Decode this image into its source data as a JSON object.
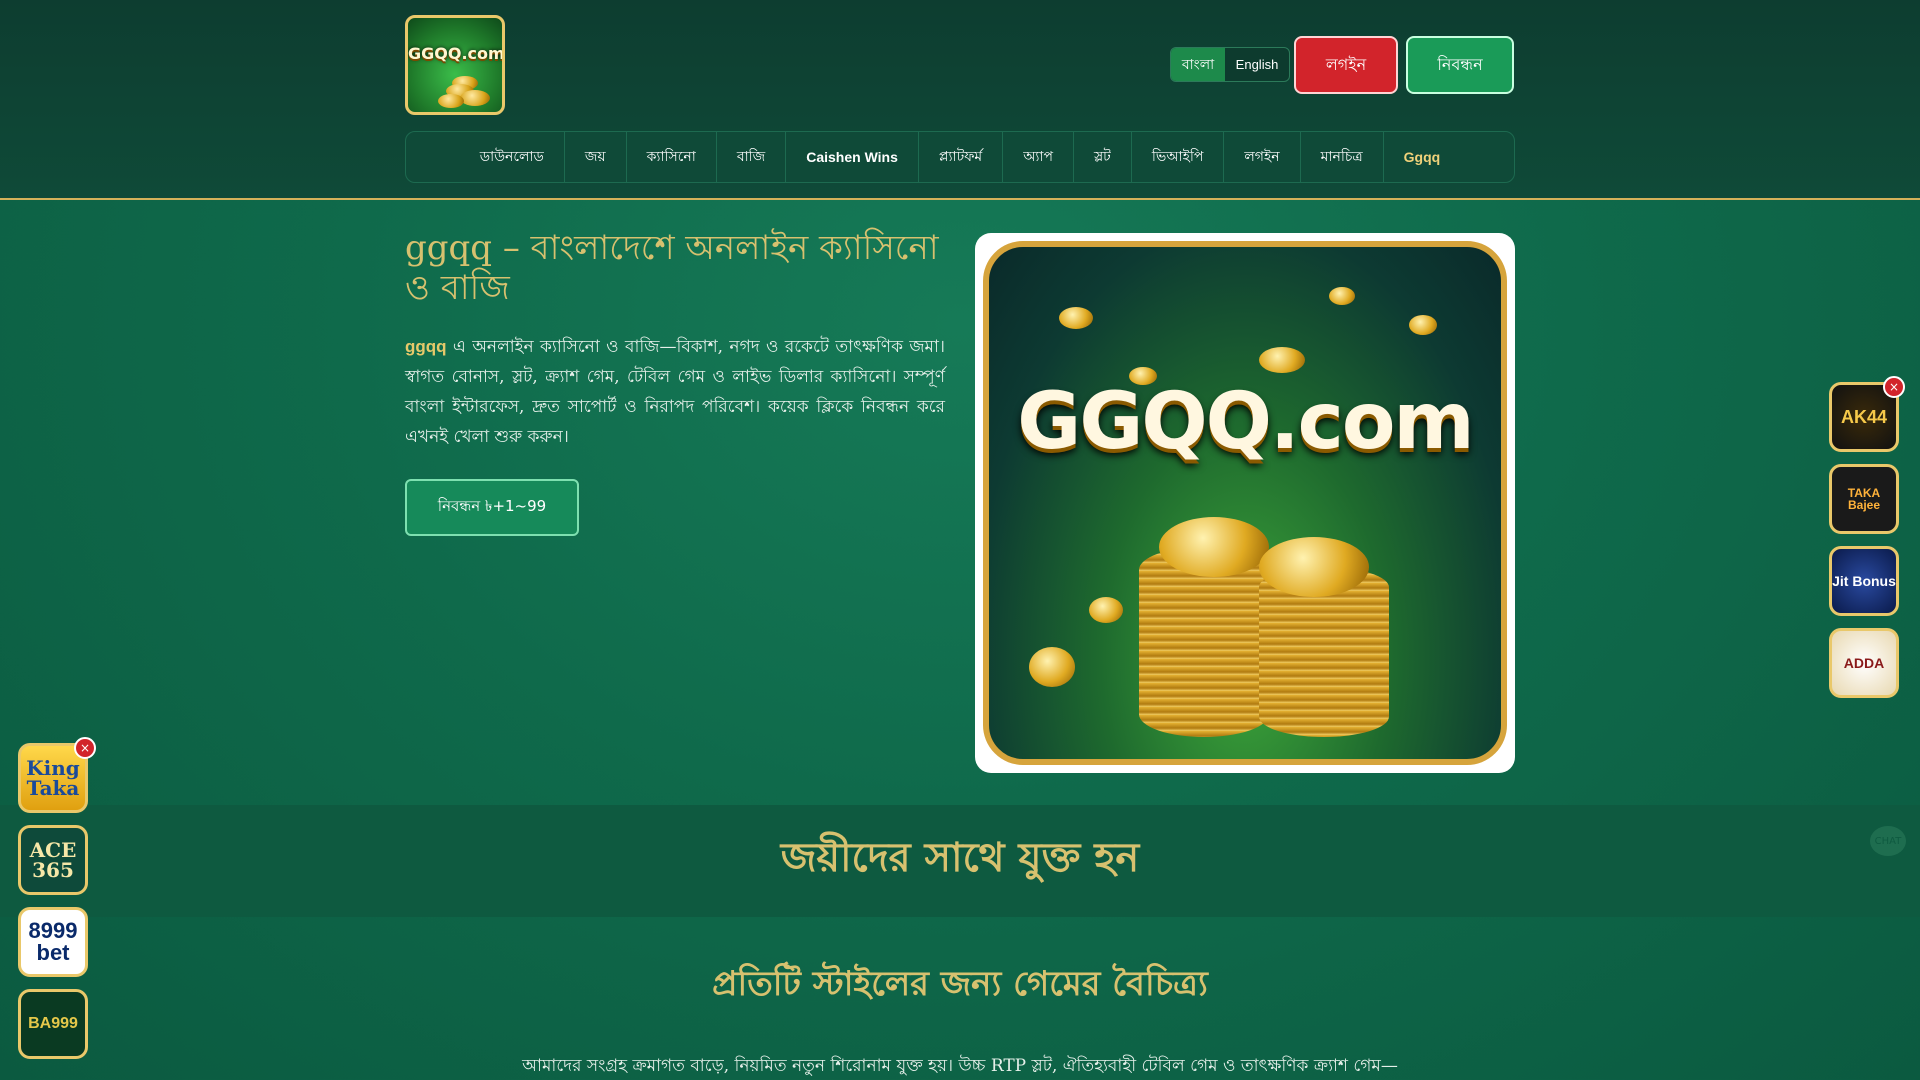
{
  "header": {
    "logo_text": "GGQQ.com",
    "lang_active": "বাংলা",
    "lang_other": "English",
    "login_label": "লগইন",
    "register_label": "নিবন্ধন"
  },
  "nav": {
    "items": [
      "ডাউনলোড",
      "জয়",
      "ক্যাসিনো",
      "বাজি",
      "Caishen Wins",
      "প্ল্যাটফর্ম",
      "অ্যাপ",
      "স্লট",
      "ভিআইপি",
      "লগইন",
      "মানচিত্র",
      "Ggqq"
    ]
  },
  "hero": {
    "title": "ggqq – বাংলাদেশে অনলাইন ক্যাসিনো ও বাজি",
    "desc_brand": "ggqq",
    "desc_rest": " এ অনলাইন ক্যাসিনো ও বাজি—বিকাশ, নগদ ও রকেটে তাৎক্ষণিক জমা। স্বাগত বোনাস, স্লট, ক্র্যাশ গেম, টেবিল গেম ও লাইভ ডিলার ক্যাসিনো। সম্পূর্ণ বাংলা ইন্টারফেস, দ্রুত সাপোর্ট ও নিরাপদ পরিবেশ। কয়েক ক্লিকে নিবন্ধন করে এখনই খেলা শুরু করুন।",
    "cta_label": "নিবন্ধন ৳+1~99",
    "image_text": "GGQQ.com"
  },
  "banner": {
    "title": "জয়ীদের সাথে যুক্ত হন"
  },
  "section": {
    "title": "প্রতিটি স্টাইলের জন্য গেমের বৈচিত্র্য",
    "desc": "আমাদের সংগ্রহ ক্রমাগত বাড়ে, নিয়মিত নতুন শিরোনাম যুক্ত হয়। উচ্চ RTP স্লট, ঐতিহ্যবাহী টেবিল গেম ও তাৎক্ষণিক ক্র্যাশ গেম—"
  },
  "left_apps": {
    "close": "×",
    "items": [
      "King Taka",
      "ACE 365",
      "8999 bet",
      "BA999"
    ]
  },
  "right_apps": {
    "close": "×",
    "items": [
      "AK44",
      "TAKA Bajee",
      "Jit Bonus",
      "ADDA"
    ]
  },
  "chat": {
    "label": "CHAT"
  },
  "colors": {
    "brand_green": "#1a9b58",
    "login_red": "#d2242b",
    "gold_text": "#d7c16f"
  }
}
